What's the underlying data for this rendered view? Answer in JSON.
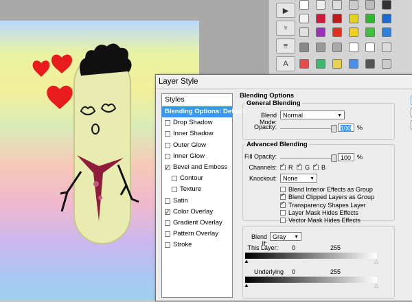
{
  "dialog": {
    "title": "Layer Style",
    "styles_header": "Styles",
    "styles": [
      {
        "label": "Blending Options: Default",
        "checkbox": false,
        "checked": false,
        "selected": true,
        "indent": false
      },
      {
        "label": "Drop Shadow",
        "checkbox": true,
        "checked": false,
        "selected": false,
        "indent": false
      },
      {
        "label": "Inner Shadow",
        "checkbox": true,
        "checked": false,
        "selected": false,
        "indent": false
      },
      {
        "label": "Outer Glow",
        "checkbox": true,
        "checked": false,
        "selected": false,
        "indent": false
      },
      {
        "label": "Inner Glow",
        "checkbox": true,
        "checked": false,
        "selected": false,
        "indent": false
      },
      {
        "label": "Bevel and Emboss",
        "checkbox": true,
        "checked": true,
        "selected": false,
        "indent": false
      },
      {
        "label": "Contour",
        "checkbox": true,
        "checked": false,
        "selected": false,
        "indent": true
      },
      {
        "label": "Texture",
        "checkbox": true,
        "checked": false,
        "selected": false,
        "indent": true
      },
      {
        "label": "Satin",
        "checkbox": true,
        "checked": false,
        "selected": false,
        "indent": false
      },
      {
        "label": "Color Overlay",
        "checkbox": true,
        "checked": true,
        "selected": false,
        "indent": false
      },
      {
        "label": "Gradient Overlay",
        "checkbox": true,
        "checked": false,
        "selected": false,
        "indent": false
      },
      {
        "label": "Pattern Overlay",
        "checkbox": true,
        "checked": false,
        "selected": false,
        "indent": false
      },
      {
        "label": "Stroke",
        "checkbox": true,
        "checked": false,
        "selected": false,
        "indent": false
      }
    ],
    "blending": {
      "section_title": "Blending Options",
      "general_title": "General Blending",
      "blend_mode_label": "Blend Mode:",
      "blend_mode_value": "Normal",
      "opacity_label": "Opacity:",
      "opacity_value": "100",
      "opacity_unit": "%",
      "advanced_title": "Advanced Blending",
      "fill_opacity_label": "Fill Opacity:",
      "fill_opacity_value": "100",
      "fill_opacity_unit": "%",
      "channels_label": "Channels:",
      "channel_r": "R",
      "channel_g": "G",
      "channel_b": "B",
      "knockout_label": "Knockout:",
      "knockout_value": "None",
      "options": [
        {
          "label": "Blend Interior Effects as Group",
          "checked": false
        },
        {
          "label": "Blend Clipped Layers as Group",
          "checked": true
        },
        {
          "label": "Transparency Shapes Layer",
          "checked": true
        },
        {
          "label": "Layer Mask Hides Effects",
          "checked": false
        },
        {
          "label": "Vector Mask Hides Effects",
          "checked": false
        }
      ],
      "blend_if_label": "Blend If:",
      "blend_if_value": "Gray",
      "this_layer_label": "This Layer:",
      "this_layer_min": "0",
      "this_layer_max": "255",
      "underlying_label": "Underlying Layer:",
      "underlying_min": "0",
      "underlying_max": "255"
    }
  },
  "colors": {
    "selection": "#3399ff",
    "dialog_bg": "#ececec"
  },
  "icons": {
    "tools": [
      "play-icon",
      "usb-icon",
      "layers-stack-icon",
      "text-tool-icon"
    ],
    "styles_palette": "style-swatches"
  }
}
